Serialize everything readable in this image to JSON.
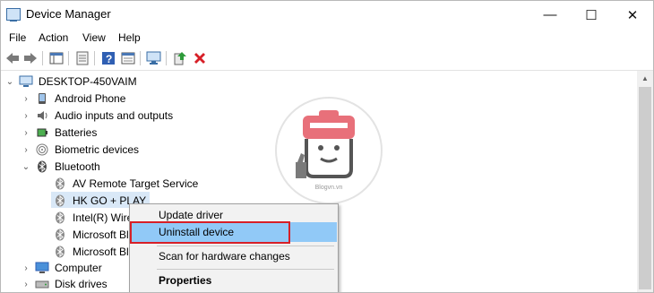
{
  "window": {
    "title": "Device Manager"
  },
  "controls": {
    "minimize": "—",
    "maximize": "☐",
    "close": "✕"
  },
  "menu": [
    "File",
    "Action",
    "View",
    "Help"
  ],
  "tree": {
    "root": "DESKTOP-450VAIM",
    "categories": {
      "android": "Android Phone",
      "audio": "Audio inputs and outputs",
      "batteries": "Batteries",
      "biometric": "Biometric devices",
      "bluetooth": "Bluetooth",
      "computer": "Computer",
      "disk": "Disk drives"
    },
    "bluetooth_devices": {
      "avrt": "AV Remote Target Service",
      "hkgo": "HK GO + PLAY",
      "intel": "Intel(R) Wire",
      "ms1": "Microsoft Bl",
      "ms2": "Microsoft Bl"
    }
  },
  "context_menu": {
    "update": "Update driver",
    "uninstall": "Uninstall device",
    "scan": "Scan for hardware changes",
    "properties": "Properties"
  },
  "watermark": {
    "text": "Blogvn.vn"
  },
  "colors": {
    "highlight": "#91c9f7",
    "selection": "#d9e8f7",
    "annotation_box": "#d71f27",
    "logo_pink": "#e8707a"
  }
}
